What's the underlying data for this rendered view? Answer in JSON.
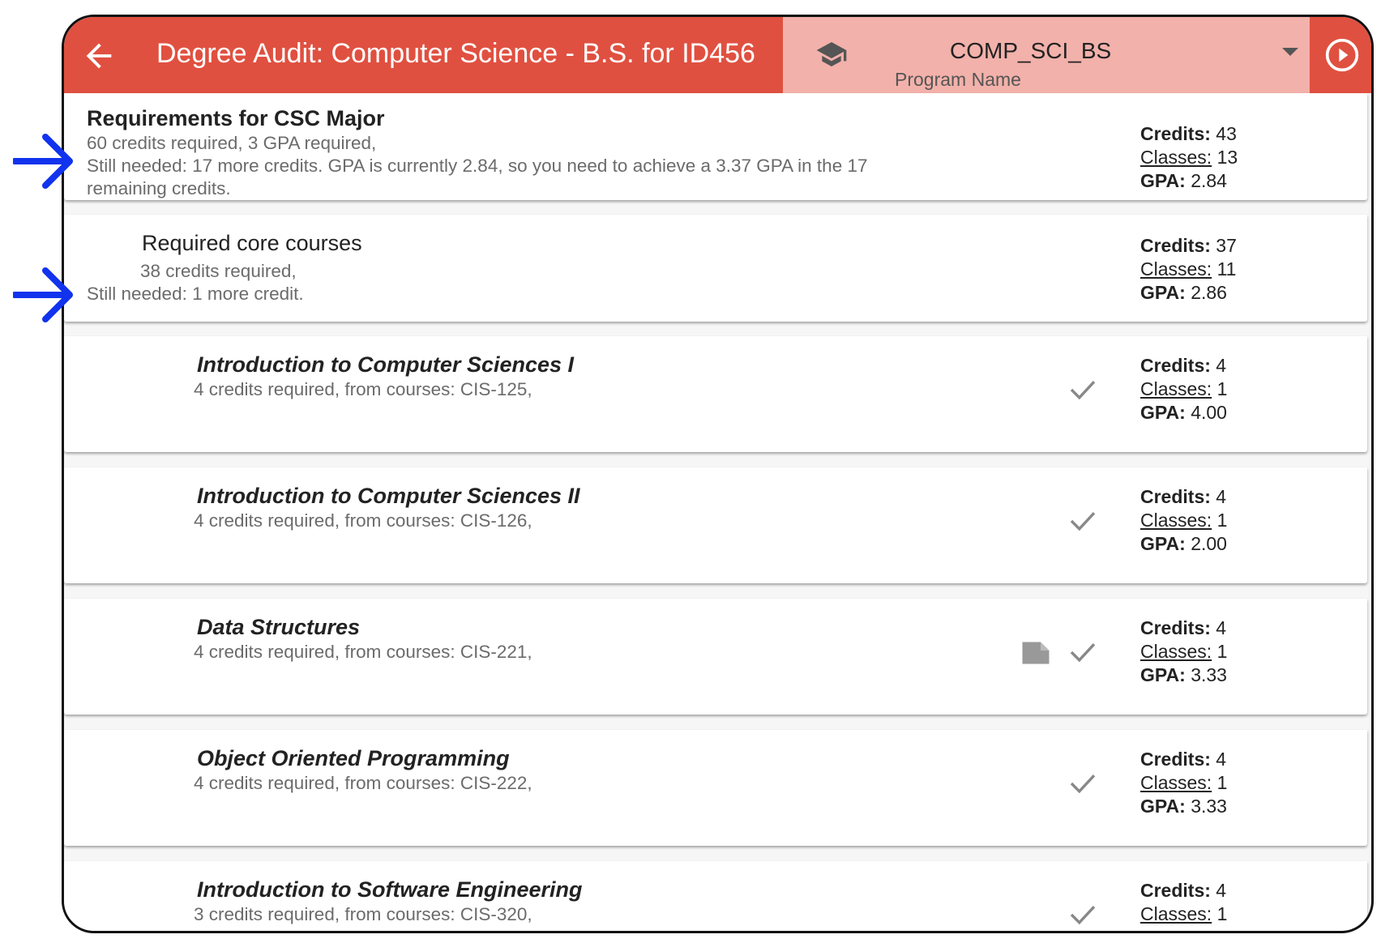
{
  "header": {
    "title": "Degree Audit: Computer Science - B.S. for ID456",
    "program_value": "COMP_SCI_BS",
    "program_label": "Program Name",
    "accent": "#e05040",
    "program_bg": "#f2b1aa"
  },
  "labels": {
    "credits": "Credits:",
    "classes": "Classes:",
    "gpa": "GPA:"
  },
  "major": {
    "title": "Requirements for CSC Major",
    "line1": "60 credits required, 3 GPA required,",
    "line2": "Still needed: 17 more credits. GPA is currently 2.84, so you need to achieve a 3.37 GPA in the 17",
    "line3": "remaining credits.",
    "credits": "43",
    "classes": "13",
    "gpa": "2.84"
  },
  "core": {
    "title": "Required core courses",
    "line1": "38 credits required,",
    "line2": "Still needed: 1 more credit.",
    "credits": "37",
    "classes": "11",
    "gpa": "2.86"
  },
  "courses": [
    {
      "title": "Introduction to Computer Sciences I",
      "sub": "4 credits required, from courses: CIS-125,",
      "credits": "4",
      "classes": "1",
      "gpa": "4.00"
    },
    {
      "title": "Introduction to Computer Sciences II",
      "sub": "4 credits required, from courses: CIS-126,",
      "credits": "4",
      "classes": "1",
      "gpa": "2.00"
    },
    {
      "title": "Data Structures",
      "sub": "4 credits required, from courses: CIS-221,",
      "credits": "4",
      "classes": "1",
      "gpa": "3.33"
    },
    {
      "title": "Object Oriented Programming",
      "sub": "4 credits required, from courses: CIS-222,",
      "credits": "4",
      "classes": "1",
      "gpa": "3.33"
    },
    {
      "title": "Introduction to Software Engineering",
      "sub": "3 credits required, from courses: CIS-320,",
      "credits": "4",
      "classes": "1",
      "gpa": ""
    }
  ],
  "icons": [
    "back-arrow-icon",
    "graduation-cap-icon",
    "dropdown-caret-icon",
    "play-circle-icon",
    "checkmark-icon",
    "note-icon",
    "annotation-arrow-icon"
  ]
}
